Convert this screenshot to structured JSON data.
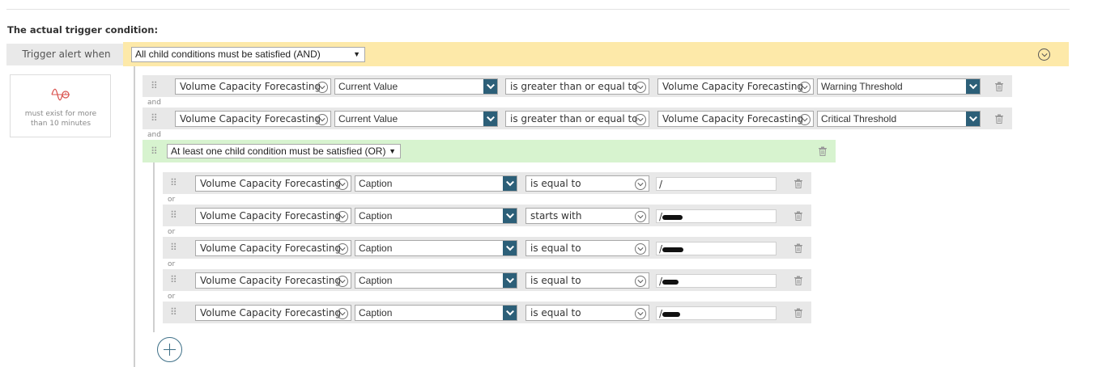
{
  "heading": "The actual trigger condition:",
  "trigger": {
    "label": "Trigger alert when",
    "mode": "All child conditions must be satisfied (AND)"
  },
  "duration": {
    "text": "must exist for more than 10 minutes",
    "icon": "wave-duration-icon"
  },
  "and_conditions": [
    {
      "entity": "Volume Capacity Forecasting",
      "field": "Current Value",
      "operator": "is greater than or equal to",
      "cmp_entity": "Volume Capacity Forecasting",
      "cmp_field": "Warning Threshold"
    },
    {
      "entity": "Volume Capacity Forecasting",
      "field": "Current Value",
      "operator": "is greater than or equal to",
      "cmp_entity": "Volume Capacity Forecasting",
      "cmp_field": "Critical Threshold"
    }
  ],
  "and_connector": "and",
  "or_group": {
    "mode": "At least one child condition must be satisfied (OR)",
    "connector": "or",
    "conditions": [
      {
        "entity": "Volume Capacity Forecasting",
        "field": "Caption",
        "operator": "is equal to",
        "value": "/"
      },
      {
        "entity": "Volume Capacity Forecasting",
        "field": "Caption",
        "operator": "starts with",
        "value": "/"
      },
      {
        "entity": "Volume Capacity Forecasting",
        "field": "Caption",
        "operator": "is equal to",
        "value": "/"
      },
      {
        "entity": "Volume Capacity Forecasting",
        "field": "Caption",
        "operator": "is equal to",
        "value": "/"
      },
      {
        "entity": "Volume Capacity Forecasting",
        "field": "Caption",
        "operator": "is equal to",
        "value": "/"
      }
    ]
  },
  "colors": {
    "accent": "#2c5f78",
    "and_band": "#fde9a9",
    "or_band": "#d7f3cf"
  }
}
